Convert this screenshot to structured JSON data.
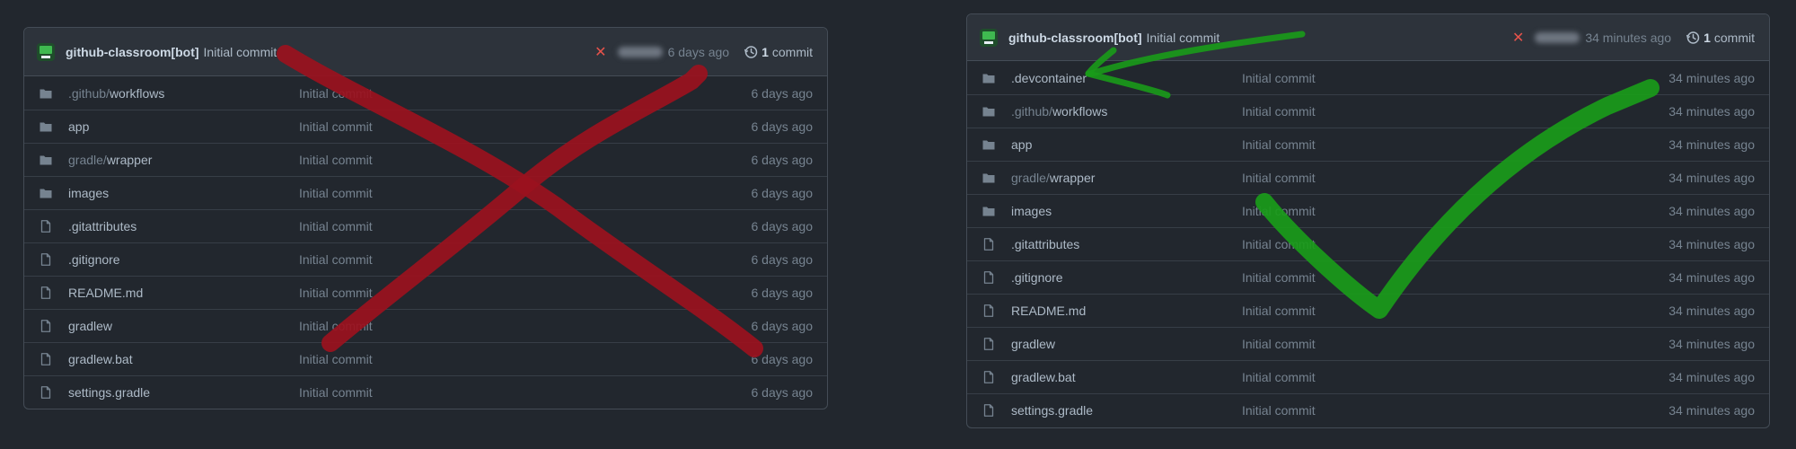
{
  "left_panel": {
    "header": {
      "author": "github-classroom[bot]",
      "message": "Initial commit",
      "status_icon": "x-icon",
      "time": "6 days ago",
      "commit_count": "1",
      "commit_label": "commit"
    },
    "files": [
      {
        "type": "folder",
        "prefix": ".github/",
        "name": "workflows",
        "message": "Initial commit",
        "age": "6 days ago"
      },
      {
        "type": "folder",
        "prefix": "",
        "name": "app",
        "message": "Initial commit",
        "age": "6 days ago"
      },
      {
        "type": "folder",
        "prefix": "gradle/",
        "name": "wrapper",
        "message": "Initial commit",
        "age": "6 days ago"
      },
      {
        "type": "folder",
        "prefix": "",
        "name": "images",
        "message": "Initial commit",
        "age": "6 days ago"
      },
      {
        "type": "file",
        "prefix": "",
        "name": ".gitattributes",
        "message": "Initial commit",
        "age": "6 days ago"
      },
      {
        "type": "file",
        "prefix": "",
        "name": ".gitignore",
        "message": "Initial commit",
        "age": "6 days ago"
      },
      {
        "type": "file",
        "prefix": "",
        "name": "README.md",
        "message": "Initial commit",
        "age": "6 days ago"
      },
      {
        "type": "file",
        "prefix": "",
        "name": "gradlew",
        "message": "Initial commit",
        "age": "6 days ago"
      },
      {
        "type": "file",
        "prefix": "",
        "name": "gradlew.bat",
        "message": "Initial commit",
        "age": "6 days ago"
      },
      {
        "type": "file",
        "prefix": "",
        "name": "settings.gradle",
        "message": "Initial commit",
        "age": "6 days ago"
      }
    ]
  },
  "right_panel": {
    "header": {
      "author": "github-classroom[bot]",
      "message": "Initial commit",
      "status_icon": "x-icon",
      "time": "34 minutes ago",
      "commit_count": "1",
      "commit_label": "commit"
    },
    "files": [
      {
        "type": "folder",
        "prefix": "",
        "name": ".devcontainer",
        "message": "Initial commit",
        "age": "34 minutes ago"
      },
      {
        "type": "folder",
        "prefix": ".github/",
        "name": "workflows",
        "message": "Initial commit",
        "age": "34 minutes ago"
      },
      {
        "type": "folder",
        "prefix": "",
        "name": "app",
        "message": "Initial commit",
        "age": "34 minutes ago"
      },
      {
        "type": "folder",
        "prefix": "gradle/",
        "name": "wrapper",
        "message": "Initial commit",
        "age": "34 minutes ago"
      },
      {
        "type": "folder",
        "prefix": "",
        "name": "images",
        "message": "Initial commit",
        "age": "34 minutes ago"
      },
      {
        "type": "file",
        "prefix": "",
        "name": ".gitattributes",
        "message": "Initial commit",
        "age": "34 minutes ago"
      },
      {
        "type": "file",
        "prefix": "",
        "name": ".gitignore",
        "message": "Initial commit",
        "age": "34 minutes ago"
      },
      {
        "type": "file",
        "prefix": "",
        "name": "README.md",
        "message": "Initial commit",
        "age": "34 minutes ago"
      },
      {
        "type": "file",
        "prefix": "",
        "name": "gradlew",
        "message": "Initial commit",
        "age": "34 minutes ago"
      },
      {
        "type": "file",
        "prefix": "",
        "name": "gradlew.bat",
        "message": "Initial commit",
        "age": "34 minutes ago"
      },
      {
        "type": "file",
        "prefix": "",
        "name": "settings.gradle",
        "message": "Initial commit",
        "age": "34 minutes ago"
      }
    ]
  },
  "annotations": {
    "wrong_mark_color": "#9b111e",
    "correct_mark_color": "#1a9b1a",
    "arrow_color": "#1a9b1a"
  },
  "colors": {
    "background": "#22272e",
    "header_bg": "#2d333b",
    "border": "#444c56",
    "folder_icon": "#768390",
    "status_fail": "#e5534b"
  }
}
